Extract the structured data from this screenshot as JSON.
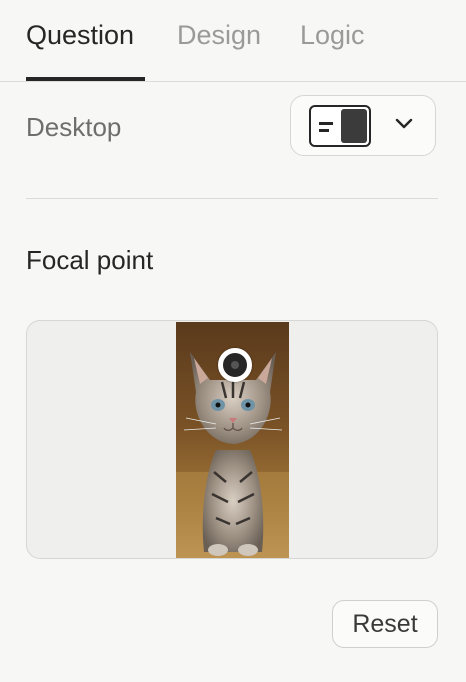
{
  "tabs": [
    {
      "label": "Question",
      "active": true
    },
    {
      "label": "Design",
      "active": false
    },
    {
      "label": "Logic",
      "active": false
    }
  ],
  "layout_row": {
    "label": "Desktop",
    "selected_layout_icon": "split-layout-icon"
  },
  "focal_section": {
    "title": "Focal point",
    "image_subject": "kitten",
    "reset_label": "Reset"
  },
  "colors": {
    "text": "#262626",
    "muted": "#9a9a98",
    "background": "#f7f7f5",
    "border": "#d6d6d4"
  }
}
